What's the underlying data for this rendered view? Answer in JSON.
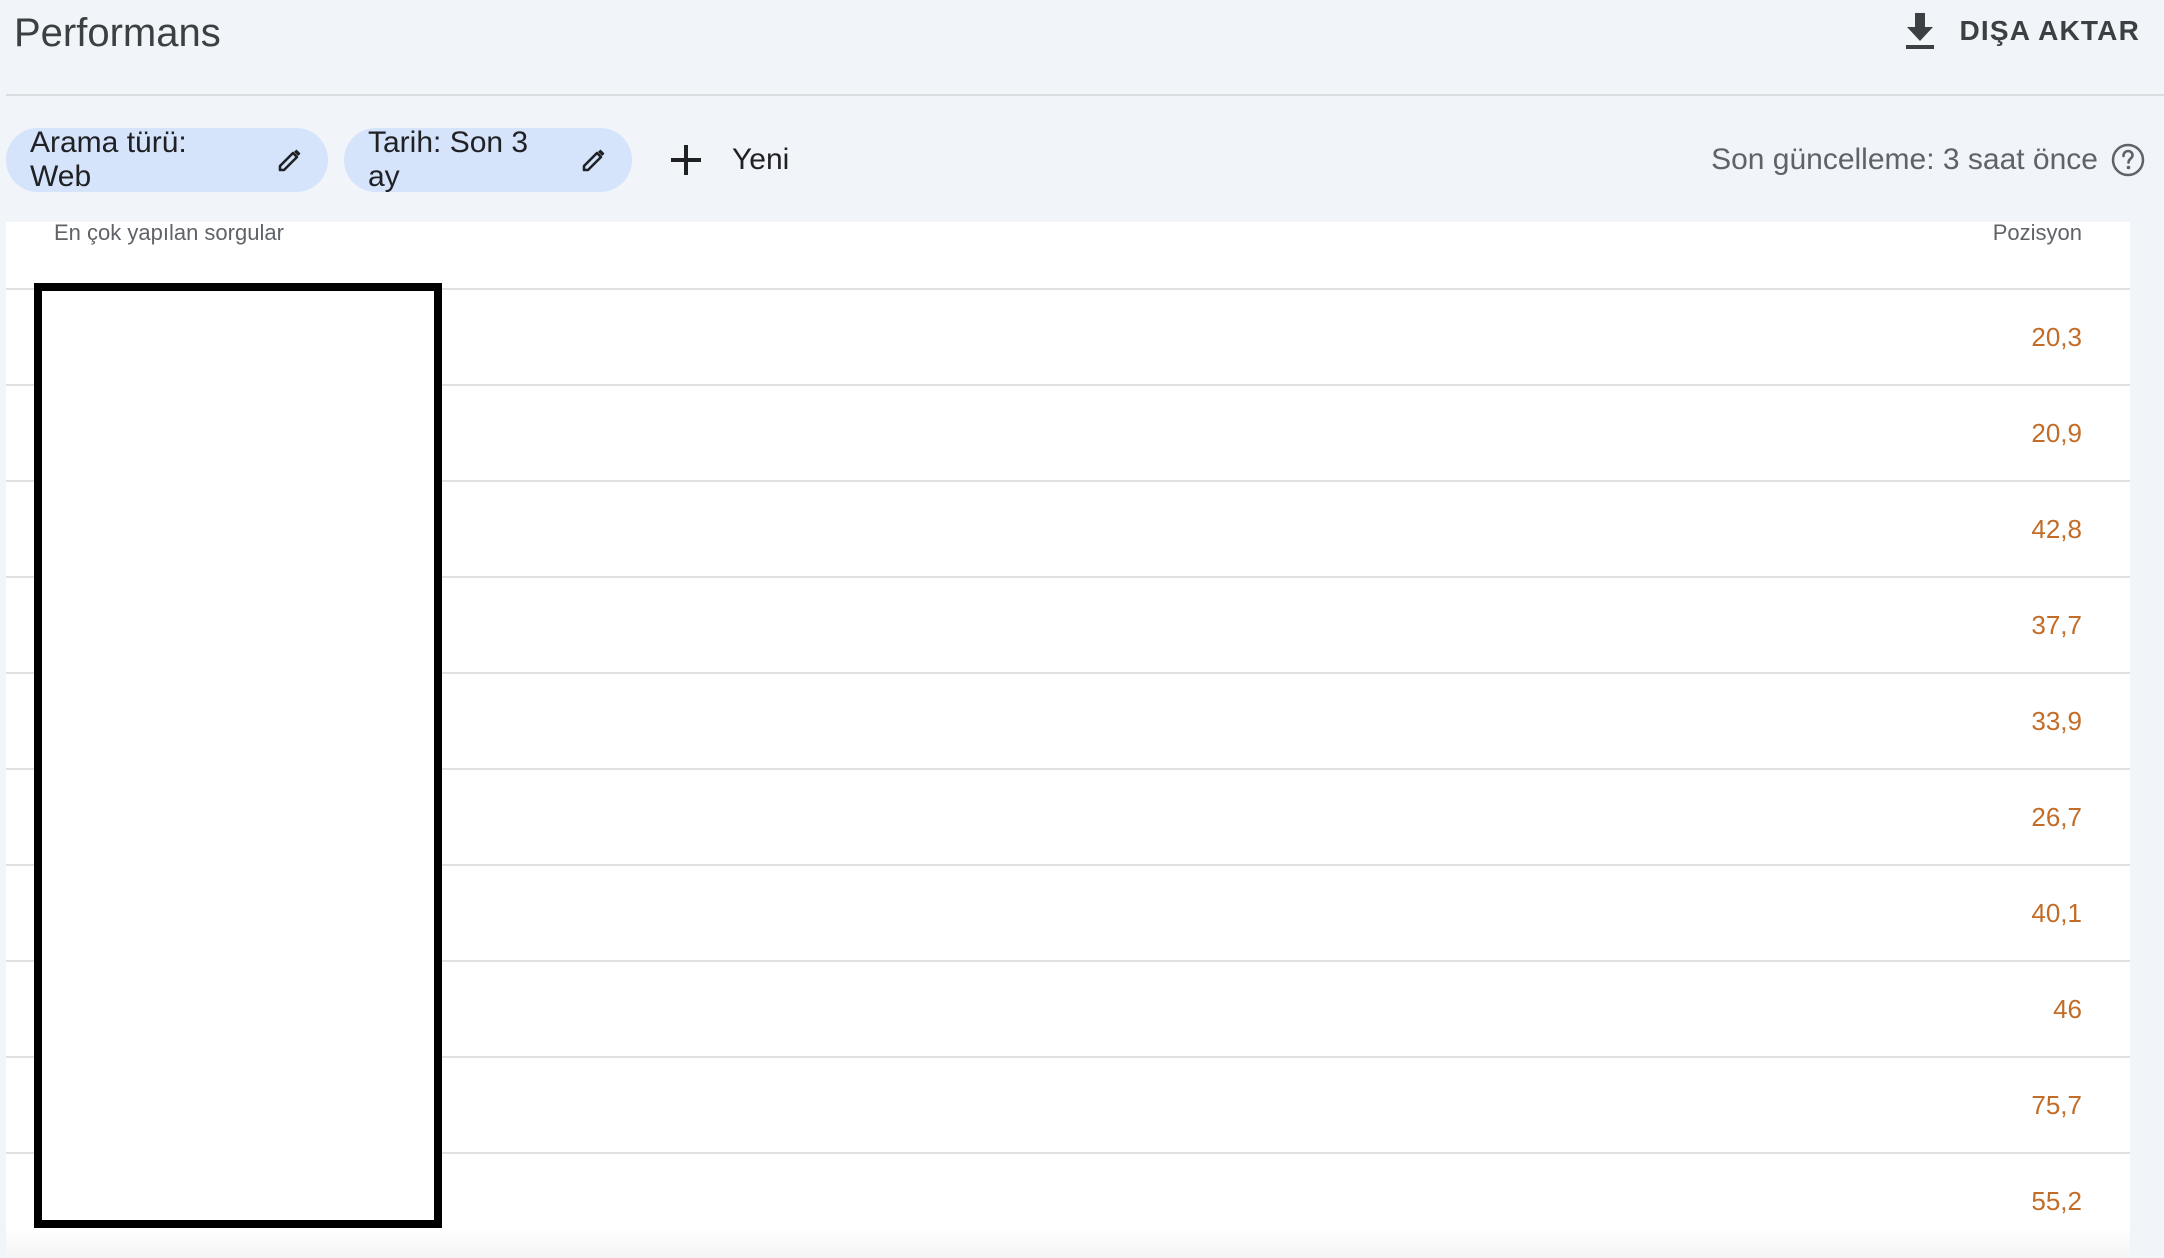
{
  "header": {
    "title": "Performans",
    "export_label": "DIŞA AKTAR"
  },
  "filters": {
    "search_type_chip": "Arama türü: Web",
    "date_chip": "Tarih: Son 3 ay",
    "new_label": "Yeni",
    "last_update": "Son güncelleme: 3 saat önce"
  },
  "table": {
    "query_column": "En çok yapılan sorgular",
    "position_column": "Pozisyon",
    "rows": [
      {
        "position": "20,3"
      },
      {
        "position": "20,9"
      },
      {
        "position": "42,8"
      },
      {
        "position": "37,7"
      },
      {
        "position": "33,9"
      },
      {
        "position": "26,7"
      },
      {
        "position": "40,1"
      },
      {
        "position": "46"
      },
      {
        "position": "75,7"
      },
      {
        "position": "55,2"
      }
    ]
  },
  "colors": {
    "chip_background": "#d5e3fb",
    "position_value": "#c26c28",
    "page_background": "#f1f4f9"
  },
  "icons": {
    "export": "download-icon",
    "edit": "pencil-icon",
    "add": "plus-icon",
    "help": "help-circle-icon"
  }
}
